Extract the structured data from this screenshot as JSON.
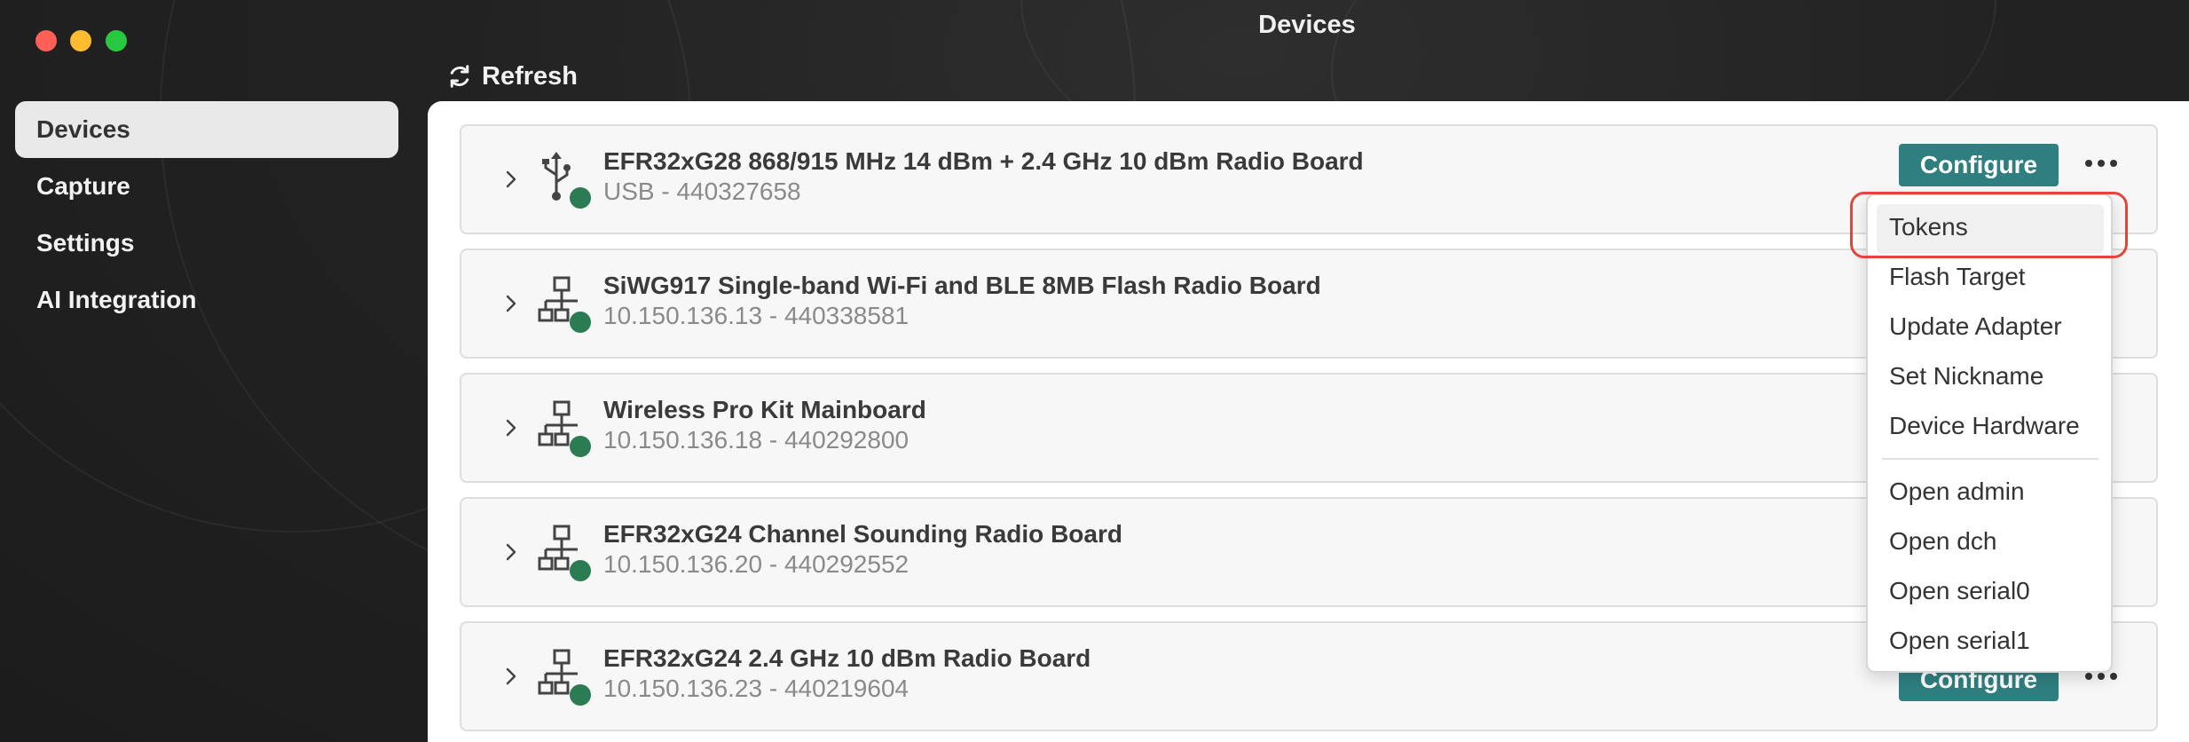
{
  "window": {
    "title": "Devices"
  },
  "toolbar": {
    "refresh_label": "Refresh"
  },
  "sidebar": {
    "items": [
      {
        "label": "Devices",
        "active": true
      },
      {
        "label": "Capture"
      },
      {
        "label": "Settings"
      },
      {
        "label": "AI Integration"
      }
    ]
  },
  "devices": [
    {
      "name": "EFR32xG28 868/915 MHz 14 dBm + 2.4 GHz 10 dBm Radio Board",
      "sub": "USB - 440327658",
      "icon": "usb-icon",
      "status": "connected",
      "configure_label": "Configure"
    },
    {
      "name": "SiWG917 Single-band Wi-Fi and BLE 8MB Flash Radio Board",
      "sub": "10.150.136.13 - 440338581",
      "icon": "network-icon",
      "status": "connected"
    },
    {
      "name": "Wireless Pro Kit Mainboard",
      "sub": "10.150.136.18 - 440292800",
      "icon": "network-icon",
      "status": "connected"
    },
    {
      "name": "EFR32xG24 Channel Sounding Radio Board",
      "sub": "10.150.136.20 - 440292552",
      "icon": "network-icon",
      "status": "connected"
    },
    {
      "name": "EFR32xG24 2.4 GHz 10 dBm Radio Board",
      "sub": "10.150.136.23 - 440219604",
      "icon": "network-icon",
      "status": "connected",
      "configure_label": "Configure"
    }
  ],
  "menu": {
    "items": [
      "Tokens",
      "Flash Target",
      "Update Adapter",
      "Set Nickname",
      "Device Hardware",
      "Open admin",
      "Open dch",
      "Open serial0",
      "Open serial1"
    ],
    "highlighted": "Tokens"
  },
  "colors": {
    "accent": "#2f7f80",
    "status_dot": "#2b7c52",
    "callout": "#e0473a"
  }
}
